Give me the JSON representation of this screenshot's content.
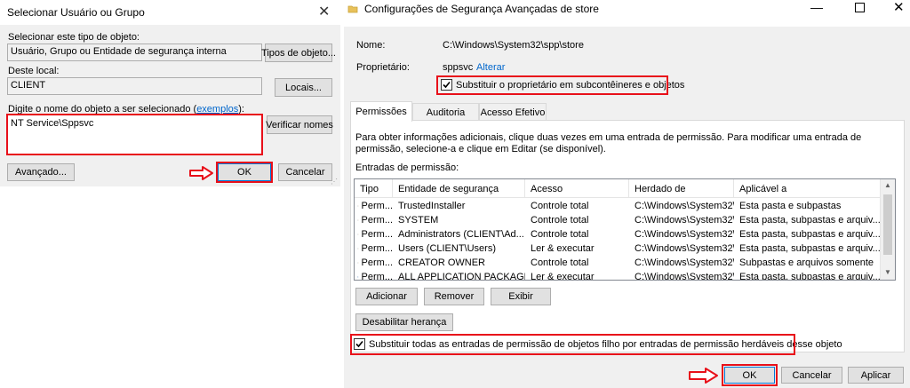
{
  "left_dialog": {
    "title": "Selecionar Usuário ou Grupo",
    "object_type_label": "Selecionar este tipo de objeto:",
    "object_type_value": "Usuário, Grupo ou Entidade de segurança interna",
    "object_types_button": "Tipos de objeto...",
    "location_label": "Deste local:",
    "location_value": "CLIENT",
    "locations_button": "Locais...",
    "name_label_prefix": "Digite o nome do objeto a ser selecionado (",
    "name_label_link": "exemplos",
    "name_label_suffix": "):",
    "name_value": "NT Service\\Sppsvc",
    "check_names_button": "Verificar nomes",
    "advanced_button": "Avançado...",
    "ok_button": "OK",
    "cancel_button": "Cancelar"
  },
  "right_dialog": {
    "title": "Configurações de Segurança Avançadas de store",
    "name_label": "Nome:",
    "name_value": "C:\\Windows\\System32\\spp\\store",
    "owner_label": "Proprietário:",
    "owner_value": "sppsvc",
    "owner_change_link": "Alterar",
    "replace_owner_checkbox": "Substituir o proprietário em subcontêineres e objetos",
    "tabs": [
      "Permissões",
      "Auditoria",
      "Acesso Efetivo"
    ],
    "info_text": "Para obter informações adicionais, clique duas vezes em uma entrada de permissão. Para modificar uma entrada de permissão, selecione-a e clique em Editar (se disponível).",
    "entries_label": "Entradas de permissão:",
    "columns": [
      "Tipo",
      "Entidade de segurança",
      "Acesso",
      "Herdado de",
      "Aplicável a"
    ],
    "rows": [
      [
        "Perm...",
        "TrustedInstaller",
        "Controle total",
        "C:\\Windows\\System32\\...",
        "Esta pasta e subpastas"
      ],
      [
        "Perm...",
        "SYSTEM",
        "Controle total",
        "C:\\Windows\\System32\\...",
        "Esta pasta, subpastas e arquiv..."
      ],
      [
        "Perm...",
        "Administrators (CLIENT\\Ad...",
        "Controle total",
        "C:\\Windows\\System32\\...",
        "Esta pasta, subpastas e arquiv..."
      ],
      [
        "Perm...",
        "Users (CLIENT\\Users)",
        "Ler & executar",
        "C:\\Windows\\System32\\...",
        "Esta pasta, subpastas e arquiv..."
      ],
      [
        "Perm...",
        "CREATOR OWNER",
        "Controle total",
        "C:\\Windows\\System32\\...",
        "Subpastas e arquivos somente"
      ],
      [
        "Perm...",
        "ALL APPLICATION PACKAGES",
        "Ler & executar",
        "C:\\Windows\\System32\\...",
        "Esta pasta, subpastas e arquiv..."
      ]
    ],
    "add_button": "Adicionar",
    "remove_button": "Remover",
    "view_button": "Exibir",
    "disable_inheritance_button": "Desabilitar herança",
    "replace_children_checkbox": "Substituir todas as entradas de permissão de objetos filho por entradas de permissão herdáveis desse objeto",
    "ok_button": "OK",
    "cancel_button": "Cancelar",
    "apply_button": "Aplicar"
  },
  "colors": {
    "highlight": "#e8101a",
    "link": "#0066cc",
    "dialog_bg": "#f0f0f0"
  }
}
